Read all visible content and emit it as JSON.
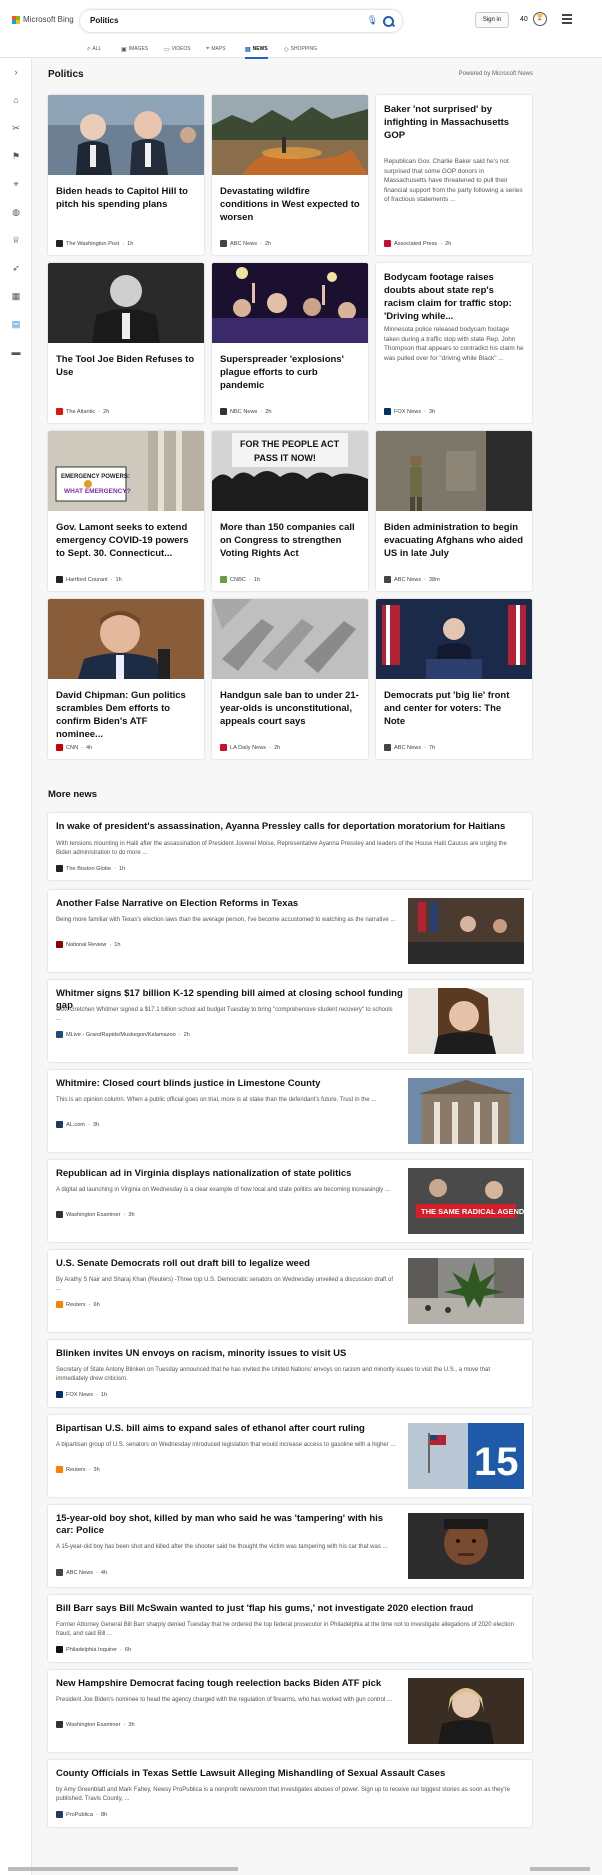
{
  "header": {
    "logo_text": "Microsoft Bing",
    "query": "Politics",
    "signin_label": "Sign in",
    "rewards_count": "40"
  },
  "tabs": [
    {
      "label": "ALL",
      "icon": "search-icon"
    },
    {
      "label": "IMAGES",
      "icon": "image-icon"
    },
    {
      "label": "VIDEOS",
      "icon": "video-icon"
    },
    {
      "label": "MAPS",
      "icon": "map-pin-icon"
    },
    {
      "label": "NEWS",
      "icon": "news-icon",
      "active": true
    },
    {
      "label": "SHOPPING",
      "icon": "tag-icon"
    }
  ],
  "sidebar_icons": [
    "expand-icon",
    "home-icon",
    "scissors-icon",
    "flag-icon",
    "location-icon",
    "globe-icon",
    "trophy-icon",
    "rocket-icon",
    "film-icon",
    "news-icon",
    "money-icon"
  ],
  "section": {
    "title": "Politics",
    "powered_by": "Powered by Microsoft News"
  },
  "cards": [
    {
      "title": "Biden heads to Capitol Hill to pitch his spending plans",
      "source": "The Washington Post",
      "age": "1h",
      "fav": "#222222"
    },
    {
      "title": "Devastating wildfire conditions in West expected to worsen",
      "source": "ABC News",
      "age": "2h",
      "fav": "#444444"
    },
    {
      "title": "Baker 'not surprised' by infighting in Massachusetts GOP",
      "snippet": "Republican Gov. Charlie Baker said he's not surprised that some GOP donors in Massachusetts have threatened to pull their financial support from the party following a series of fractious statements ...",
      "source": "Associated Press",
      "age": "2h",
      "fav": "#c8102e"
    },
    {
      "title": "The Tool Joe Biden Refuses to Use",
      "source": "The Atlantic",
      "age": "2h",
      "fav": "#e3120b"
    },
    {
      "title": "Superspreader 'explosions' plague efforts to curb pandemic",
      "source": "NBC News",
      "age": "2h",
      "fav": "#333333"
    },
    {
      "title": "Bodycam footage raises doubts about state rep's racism claim for traffic stop: 'Driving while...",
      "snippet": "Minnesota police released bodycam footage taken during a traffic stop with state Rep. John Thompson that appears to contradict his claim he was pulled over for \"driving while Black\" ...",
      "source": "FOX News",
      "age": "3h",
      "fav": "#003366"
    },
    {
      "title": "Gov. Lamont seeks to extend emergency COVID-19 powers to Sept. 30. Connecticut...",
      "source": "Hartford Courant",
      "age": "1h",
      "fav": "#222222"
    },
    {
      "title": "More than 150 companies call on Congress to strengthen Voting Rights Act",
      "source": "CNBC",
      "age": "1h",
      "fav": "#6c9c3e"
    },
    {
      "title": "Biden administration to begin evacuating Afghans who aided US in late July",
      "source": "ABC News",
      "age": "38m",
      "fav": "#444444"
    },
    {
      "title": "David Chipman: Gun politics scrambles Dem efforts to confirm Biden's ATF nominee...",
      "source": "CNN",
      "age": "4h",
      "fav": "#cc0000"
    },
    {
      "title": "Handgun sale ban to under 21-year-olds is unconstitutional, appeals court says",
      "source": "LA Daily News",
      "age": "2h",
      "fav": "#c8102e"
    },
    {
      "title": "Democrats put 'big lie' front and center for voters: The Note",
      "source": "ABC News",
      "age": "7h",
      "fav": "#444444"
    }
  ],
  "image_texts": {
    "emergency_sign": "EMERGENCY POWERS: WHAT EMERGENCY?",
    "people_act_sign": "FOR THE PEOPLE ACT PASS IT NOW!",
    "radical_agenda": "THE SAME RADICAL AGENDA.",
    "number_15": "15"
  },
  "more_news": {
    "title": "More news",
    "items": [
      {
        "title": "In wake of president's assassination, Ayanna Pressley calls for deportation moratorium for Haitians",
        "snippet": "With tensions mounting in Haiti after the assassination of President Jovenel Moise, Representative Ayanna Pressley and leaders of the House Haiti Caucus are urging the Biden administration to do more ...",
        "source": "The Boston Globe",
        "age": "1h",
        "fav": "#222222"
      },
      {
        "title": "Another False Narrative on Election Reforms in Texas",
        "snippet": "Being more familiar with Texas's election laws than the average person, I've become accustomed to watching as the narrative ...",
        "source": "National Review",
        "age": "1h",
        "fav": "#8b0000"
      },
      {
        "title": "Whitmer signs $17 billion K-12 spending bill aimed at closing school funding gap",
        "snippet": "Gov. Gretchen Whitmer signed a $17.1 billion school aid budget Tuesday to bring \"comprehensive student recovery\" to schools ...",
        "source": "MLive - GrandRapids/Muskegon/Kalamazoo",
        "age": "2h",
        "fav": "#1f4e79"
      },
      {
        "title": "Whitmire: Closed court blinds justice in Limestone County",
        "snippet": "This is an opinion column. When a public official goes on trial, more is at stake than the defendant's future. Trust in the ...",
        "source": "AL.com",
        "age": "3h",
        "fav": "#1f3a5f"
      },
      {
        "title": "Republican ad in Virginia displays nationalization of state politics",
        "snippet": "A digital ad launching in Virginia on Wednesday is a clear example of how local and state politics are becoming increasingly ...",
        "source": "Washington Examiner",
        "age": "3h",
        "fav": "#333333"
      },
      {
        "title": "U.S. Senate Democrats roll out draft bill to legalize weed",
        "snippet": "By Arathy S Nair and Sharaj Khan (Reuters) -Three top U.S. Democratic senators on Wednesday unveiled a discussion draft of ...",
        "source": "Reuters",
        "age": "6h",
        "fav": "#ff8000"
      },
      {
        "title": "Blinken invites UN envoys on racism, minority issues to visit US",
        "snippet": "Secretary of State Antony Blinken on Tuesday announced that he has invited the United Nations' envoys on racism and minority issues to visit the U.S., a move that immediately drew criticism.",
        "source": "FOX News",
        "age": "1h",
        "fav": "#003366"
      },
      {
        "title": "Bipartisan U.S. bill aims to expand sales of ethanol after court ruling",
        "snippet": "A bipartisan group of U.S. senators on Wednesday introduced legislation that would increase access to gasoline with a higher ...",
        "source": "Reuters",
        "age": "3h",
        "fav": "#ff8000"
      },
      {
        "title": "15-year-old boy shot, killed by man who said he was 'tampering' with his car: Police",
        "snippet": "A 15-year-old boy has been shot and killed after the shooter said he thought the victim was tampering with his car that was ...",
        "source": "ABC News",
        "age": "4h",
        "fav": "#444444"
      },
      {
        "title": "Bill Barr says Bill McSwain wanted to just 'flap his gums,' not investigate 2020 election fraud",
        "snippet": "Former Attorney General Bill Barr sharply denied Tuesday that he ordered the top federal prosecutor in Philadelphia at the time not to investigate allegations of 2020 election fraud, and said Bill ...",
        "source": "Philadelphia Inquirer",
        "age": "6h",
        "fav": "#111111"
      },
      {
        "title": "New Hampshire Democrat facing tough reelection backs Biden ATF pick",
        "snippet": "President Joe Biden's nominee to head the agency charged with the regulation of firearms, who has worked with gun control ...",
        "source": "Washington Examiner",
        "age": "3h",
        "fav": "#333333"
      },
      {
        "title": "County Officials in Texas Settle Lawsuit Alleging Mishandling of Sexual Assault Cases",
        "snippet": "by Amy Greenblatt and Mark Fahey, Newsy ProPublica is a nonprofit newsroom that investigates abuses of power. Sign up to receive our biggest stories as soon as they're published. Travis County, ...",
        "source": "ProPublica",
        "age": "8h",
        "fav": "#1f3a5f"
      }
    ]
  }
}
